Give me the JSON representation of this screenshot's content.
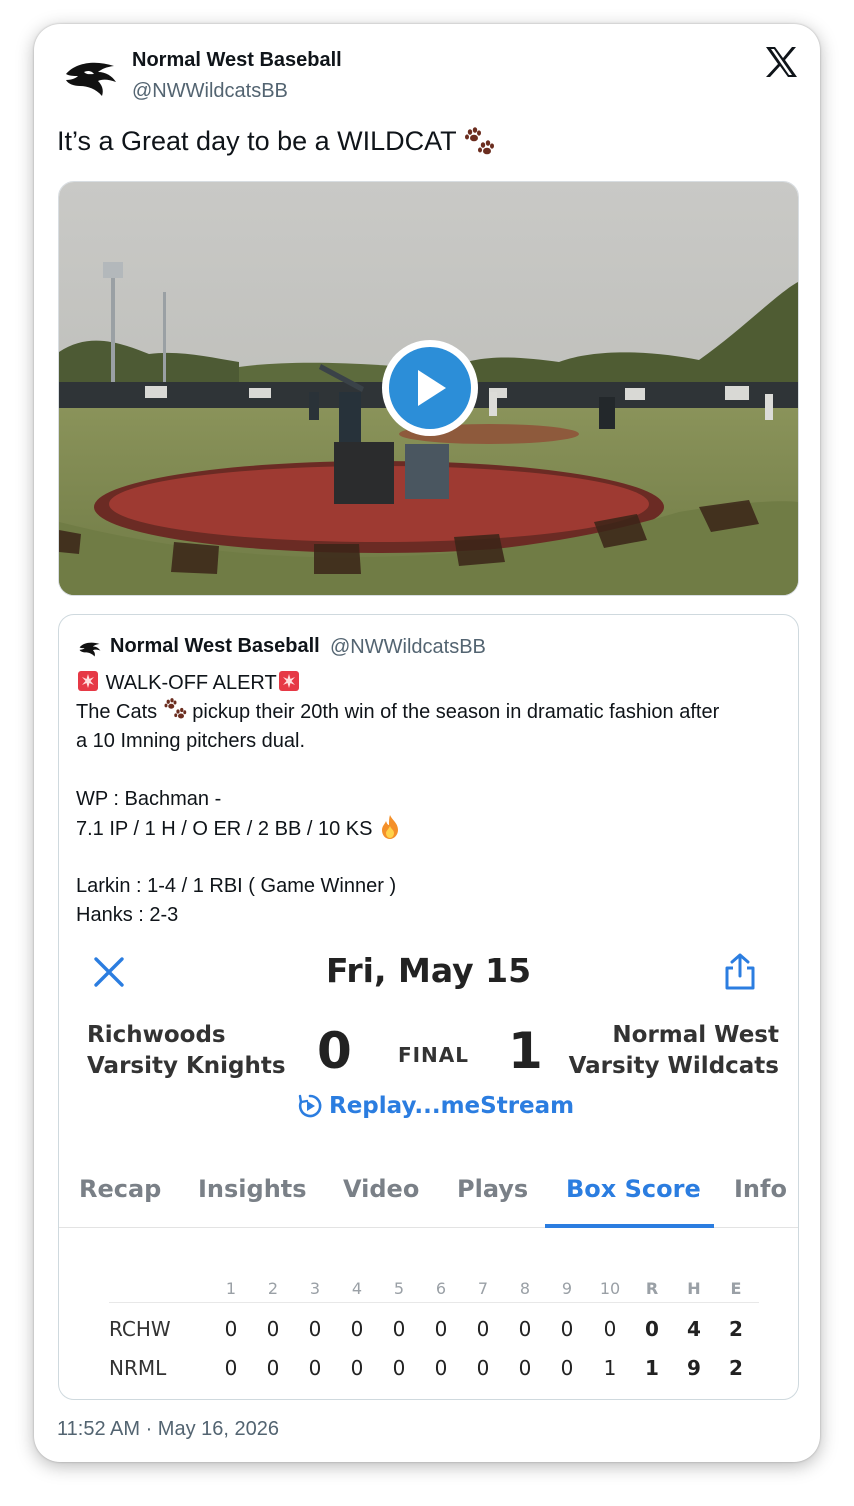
{
  "author": {
    "name": "Normal West Baseball",
    "handle": "@NWWildcatsBB"
  },
  "tweet": {
    "text": "It’s a Great day to be a WILDCAT",
    "timestamp": "11:52 AM · May 16, 2026"
  },
  "video": {
    "play_icon": "play-icon"
  },
  "quoted": {
    "name": "Normal West Baseball",
    "handle": "@NWWildcatsBB",
    "alert": "WALK-OFF ALERT",
    "line1a": "The Cats",
    "line1b": "pickup their 20th win of the season in dramatic fashion after",
    "line2": "a 10 Imning pitchers dual.",
    "line3": "WP : Bachman -",
    "line4": "7.1 IP / 1 H / O ER / 2 BB / 10 KS",
    "line5": "Larkin : 1-4 / 1 RBI ( Game Winner )",
    "line6": "Hanks : 2-3"
  },
  "scoreboard": {
    "date": "Fri, May 15",
    "away_team_line1": "Richwoods",
    "away_team_line2": "Varsity Knights",
    "home_team_line1": "Normal West",
    "home_team_line2": "Varsity Wildcats",
    "away_score": "0",
    "home_score": "1",
    "status": "FINAL",
    "replay_label": "Replay...meStream",
    "tabs": [
      "Recap",
      "Insights",
      "Video",
      "Plays",
      "Box Score",
      "Info"
    ],
    "active_tab": "Box Score",
    "box_headers": [
      "1",
      "2",
      "3",
      "4",
      "5",
      "6",
      "7",
      "8",
      "9",
      "10",
      "R",
      "H",
      "E"
    ],
    "rows": [
      {
        "team": "RCHW",
        "cells": [
          "0",
          "0",
          "0",
          "0",
          "0",
          "0",
          "0",
          "0",
          "0",
          "0",
          "0",
          "4",
          "2"
        ]
      },
      {
        "team": "NRML",
        "cells": [
          "0",
          "0",
          "0",
          "0",
          "0",
          "0",
          "0",
          "0",
          "0",
          "1",
          "1",
          "9",
          "2"
        ]
      }
    ]
  },
  "colors": {
    "accent": "#2b7de0",
    "play_button": "#2c8ed8",
    "paw": "#6b2d1f",
    "siren": "#e63946"
  }
}
